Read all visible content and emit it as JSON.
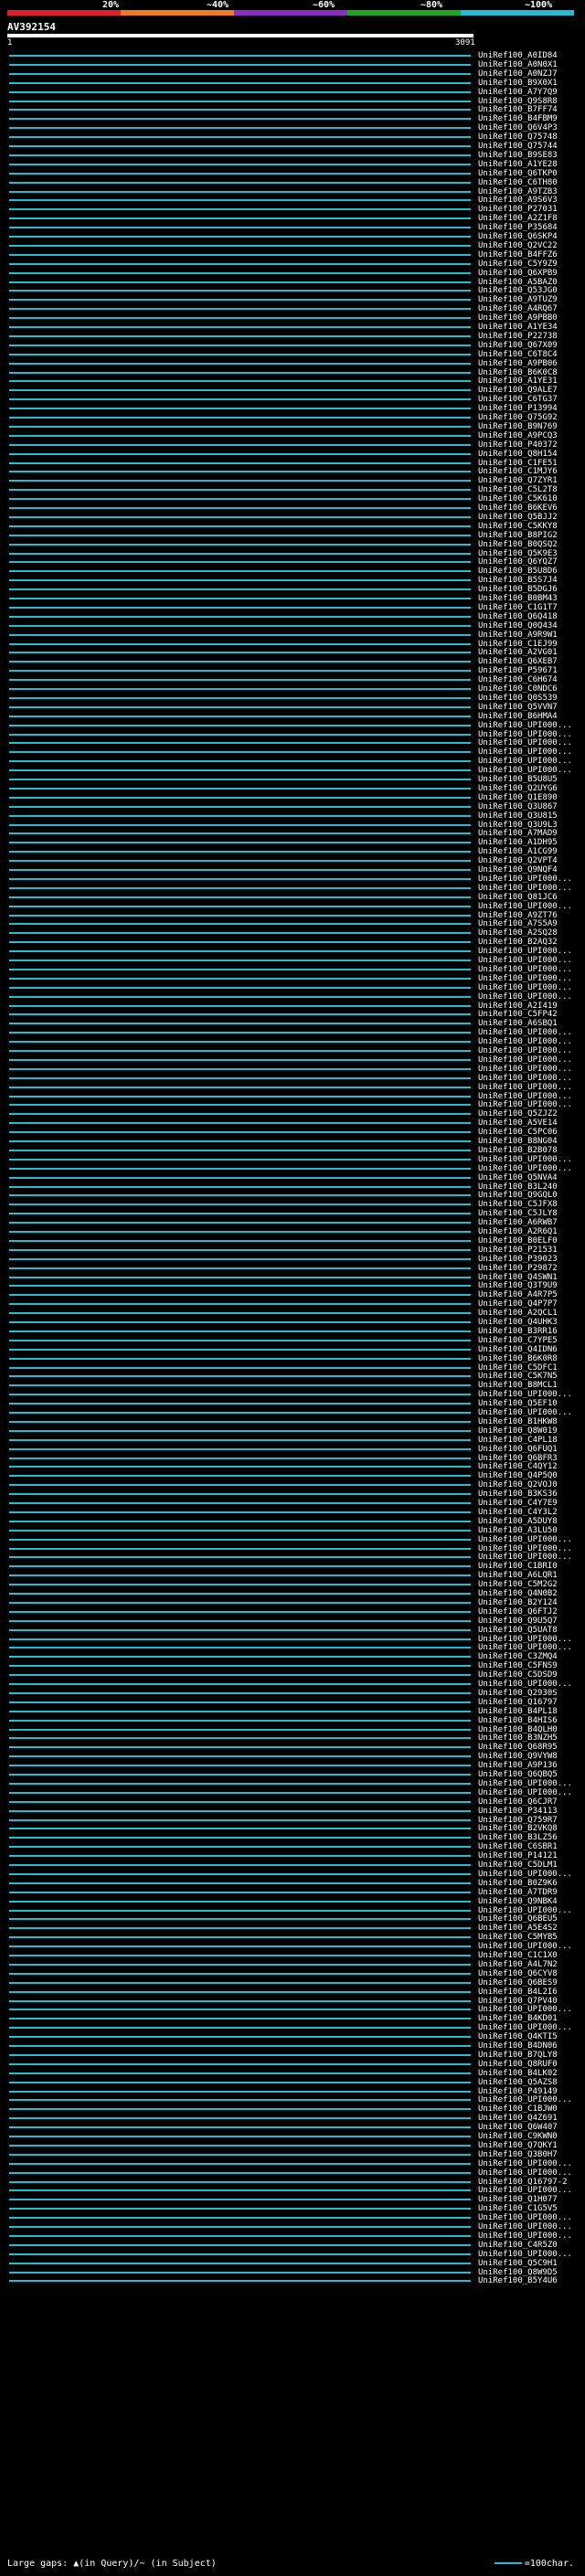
{
  "legend": {
    "labels": [
      "20%",
      "~40%",
      "~60%",
      "~80%",
      "~100%"
    ],
    "colors": [
      "#e0202a",
      "#f07a20",
      "#8c2bbf",
      "#1fa81f",
      "#22bcd4"
    ]
  },
  "query": {
    "id": "AV392154",
    "start": "1",
    "end": "3091"
  },
  "hits": [
    "UniRef100_A0ID84",
    "UniRef100_A0N0X1",
    "UniRef100_A0NZJ7",
    "UniRef100_B9X0X1",
    "UniRef100_A7Y7Q9",
    "UniRef100_Q9S8R8",
    "UniRef100_B7FF74",
    "UniRef100_B4FBM9",
    "UniRef100_Q6V4P3",
    "UniRef100_Q75748",
    "UniRef100_Q75744",
    "UniRef100_B9SE83",
    "UniRef100_A1YE28",
    "UniRef100_Q6TKP0",
    "UniRef100_C6TH80",
    "UniRef100_A9TZB3",
    "UniRef100_A9S6V3",
    "UniRef100_P27031",
    "UniRef100_A2Z1F8",
    "UniRef100_P35684",
    "UniRef100_Q6SKP4",
    "UniRef100_Q2VC22",
    "UniRef100_B4FFZ6",
    "UniRef100_C5Y9Z9",
    "UniRef100_Q6XPB9",
    "UniRef100_A5BAZ0",
    "UniRef100_Q53JG0",
    "UniRef100_A9TUZ9",
    "UniRef100_A4RQ67",
    "UniRef100_A9PBB0",
    "UniRef100_A1YE34",
    "UniRef100_P22738",
    "UniRef100_Q67X09",
    "UniRef100_C6T8C4",
    "UniRef100_A9PB06",
    "UniRef100_B6K0C8",
    "UniRef100_A1YE31",
    "UniRef100_Q9ALE7",
    "UniRef100_C6TG37",
    "UniRef100_P13994",
    "UniRef100_Q75G92",
    "UniRef100_B9N769",
    "UniRef100_A9PCQ3",
    "UniRef100_P40372",
    "UniRef100_Q8H154",
    "UniRef100_C1FE51",
    "UniRef100_C1MJY6",
    "UniRef100_Q7ZYR1",
    "UniRef100_C5L2T8",
    "UniRef100_C5K610",
    "UniRef100_B6KEV6",
    "UniRef100_Q5BJJ2",
    "UniRef100_C5KKY8",
    "UniRef100_B8PIG2",
    "UniRef100_B0QSQ2",
    "UniRef100_Q5K9E3",
    "UniRef100_Q6YQZ7",
    "UniRef100_B5U8D6",
    "UniRef100_B5S7J4",
    "UniRef100_B5DGJ6",
    "UniRef100_B0BM43",
    "UniRef100_C1G1T7",
    "UniRef100_Q6Q418",
    "UniRef100_Q0Q434",
    "UniRef100_A9R9W1",
    "UniRef100_C1EJ99",
    "UniRef100_A2VG01",
    "UniRef100_Q6XEB7",
    "UniRef100_P59671",
    "UniRef100_C6H674",
    "UniRef100_C0NDC6",
    "UniRef100_Q0S539",
    "UniRef100_Q5VVN7",
    "UniRef100_B6HMA4",
    "UniRef100_UPI000...",
    "UniRef100_UPI000...",
    "UniRef100_UPI000...",
    "UniRef100_UPI000...",
    "UniRef100_UPI000...",
    "UniRef100_UPI000...",
    "UniRef100_B5U8U5",
    "UniRef100_Q2UYG6",
    "UniRef100_Q1E890",
    "UniRef100_Q3U867",
    "UniRef100_Q3U815",
    "UniRef100_Q3U9L3",
    "UniRef100_A7MAD9",
    "UniRef100_A1DH95",
    "UniRef100_A1CG99",
    "UniRef100_Q2VPT4",
    "UniRef100_Q9NQF4",
    "UniRef100_UPI000...",
    "UniRef100_UPI000...",
    "UniRef100_Q81JC6",
    "UniRef100_UPI000...",
    "UniRef100_A9ZT76",
    "UniRef100_A7S5A9",
    "UniRef100_A2SQ28",
    "UniRef100_B2AQ32",
    "UniRef100_UPI000...",
    "UniRef100_UPI000...",
    "UniRef100_UPI000...",
    "UniRef100_UPI000...",
    "UniRef100_UPI000...",
    "UniRef100_UPI000...",
    "UniRef100_A2I419",
    "UniRef100_C5FP42",
    "UniRef100_A6SBQ1",
    "UniRef100_UPI000...",
    "UniRef100_UPI000...",
    "UniRef100_UPI000...",
    "UniRef100_UPI000...",
    "UniRef100_UPI000...",
    "UniRef100_UPI000...",
    "UniRef100_UPI000...",
    "UniRef100_UPI000...",
    "UniRef100_UPI000...",
    "UniRef100_Q5ZJZ2",
    "UniRef100_A5VE14",
    "UniRef100_C5PC06",
    "UniRef100_B8NG04",
    "UniRef100_B2B078",
    "UniRef100_UPI000...",
    "UniRef100_UPI000...",
    "UniRef100_Q5NVA4",
    "UniRef100_B3L240",
    "UniRef100_Q9GQL0",
    "UniRef100_C5JFX8",
    "UniRef100_C5JLY8",
    "UniRef100_A6RWB7",
    "UniRef100_A2R6Q1",
    "UniRef100_B0ELF0",
    "UniRef100_P21531",
    "UniRef100_P39023",
    "UniRef100_P29872",
    "UniRef100_Q4SWN1",
    "UniRef100_Q3T9U9",
    "UniRef100_A4R7P5",
    "UniRef100_Q4P7P7",
    "UniRef100_A2QCL1",
    "UniRef100_Q4UHK3",
    "UniRef100_B3RR16",
    "UniRef100_C7YPE5",
    "UniRef100_Q4IDN6",
    "UniRef100_B6K0R8",
    "UniRef100_C5DFC1",
    "UniRef100_C5K7N5",
    "UniRef100_B8MCL1",
    "UniRef100_UPI000...",
    "UniRef100_Q5EF10",
    "UniRef100_UPI000...",
    "UniRef100_B1HKW8",
    "UniRef100_Q8W019",
    "UniRef100_C4PL18",
    "UniRef100_Q6FUQ1",
    "UniRef100_Q6BFR3",
    "UniRef100_C4QY12",
    "UniRef100_Q4P5Q0",
    "UniRef100_Q2VOJ0",
    "UniRef100_B3KS36",
    "UniRef100_C4Y7E9",
    "UniRef100_C4Y3L2",
    "UniRef100_A5DUY8",
    "UniRef100_A3LU50",
    "UniRef100_UPI000...",
    "UniRef100_UPI000...",
    "UniRef100_UPI000...",
    "UniRef100_C1BRI0",
    "UniRef100_A6LQR1",
    "UniRef100_C5M2G2",
    "UniRef100_Q4N0B2",
    "UniRef100_B2Y124",
    "UniRef100_Q6FTJ2",
    "UniRef100_Q9U5Q7",
    "UniRef100_Q5UAT8",
    "UniRef100_UPI000...",
    "UniRef100_UPI000...",
    "UniRef100_C3ZMQ4",
    "UniRef100_C5FNS9",
    "UniRef100_C5DSD9",
    "UniRef100_UPI000...",
    "UniRef100_Q2930S",
    "UniRef100_Q16797",
    "UniRef100_B4PL18",
    "UniRef100_B4HIS6",
    "UniRef100_B4QLH0",
    "UniRef100_B3NZH5",
    "UniRef100_Q68R95",
    "UniRef100_Q9VYW8",
    "UniRef100_A9P136",
    "UniRef100_Q6QBQ5",
    "UniRef100_UPI000...",
    "UniRef100_UPI000...",
    "UniRef100_Q6CJR7",
    "UniRef100_P34113",
    "UniRef100_Q759R7",
    "UniRef100_B2VKQ8",
    "UniRef100_B3LZ56",
    "UniRef100_C6SBR1",
    "UniRef100_P14121",
    "UniRef100_C5DLM1",
    "UniRef100_UPI000...",
    "UniRef100_B0Z9K6",
    "UniRef100_A7TDR9",
    "UniRef100_Q9NBK4",
    "UniRef100_UPI000...",
    "UniRef100_Q6BEU5",
    "UniRef100_A5E4S2",
    "UniRef100_C5MYB5",
    "UniRef100_UPI000...",
    "UniRef100_C1C1X0",
    "UniRef100_A4L7N2",
    "UniRef100_Q6CYV8",
    "UniRef100_Q6BES9",
    "UniRef100_B4L2I6",
    "UniRef100_Q7PV40",
    "UniRef100_UPI000...",
    "UniRef100_B4KD01",
    "UniRef100_UPI000...",
    "UniRef100_Q4KTI5",
    "UniRef100_B4DN06",
    "UniRef100_B7QLY8",
    "UniRef100_Q8RUF0",
    "UniRef100_B4LK02",
    "UniRef100_Q5AZS8",
    "UniRef100_P49149",
    "UniRef100_UPI000...",
    "UniRef100_C1BJW0",
    "UniRef100_Q4Z691",
    "UniRef100_Q6W407",
    "UniRef100_C9KWN0",
    "UniRef100_Q7QKY1",
    "UniRef100_Q3B0H7",
    "UniRef100_UPI000...",
    "UniRef100_UPI000...",
    "UniRef100_Q16797-2",
    "UniRef100_UPI000...",
    "UniRef100_Q1H077",
    "UniRef100_C1G5V5",
    "UniRef100_UPI000...",
    "UniRef100_UPI000...",
    "UniRef100_UPI000...",
    "UniRef100_C4R5Z0",
    "UniRef100_UPI000...",
    "UniRef100_Q5C9H1",
    "UniRef100_Q8W9D5",
    "UniRef100_B5Y4U6"
  ],
  "footer": {
    "left": "Large gaps: ▲(in Query)/~ (in Subject)",
    "right": "=100char."
  }
}
